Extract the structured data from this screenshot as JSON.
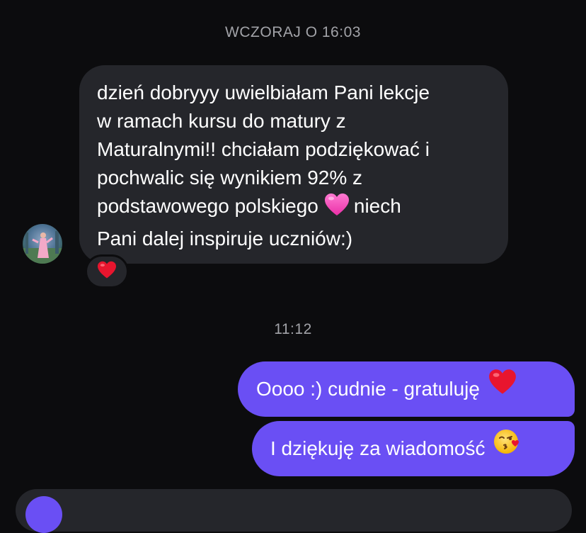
{
  "thread": {
    "timestamp_1": "WCZORAJ O 16:03",
    "timestamp_2": "11:12"
  },
  "incoming_message": {
    "lines": [
      "dzień dobryyy uwielbiałam Pani lekcje",
      "w ramach kursu do matury z",
      "Maturalnymi!! chciałam podziękować i",
      "pochwalic się wynikiem 92% z",
      "podstawowego polskiego",
      "niech",
      "Pani dalej inspiruje uczniów:)"
    ],
    "inline_emoji": "pink-heart-icon",
    "reaction_emoji": "red-heart-icon"
  },
  "outgoing_messages": [
    {
      "text": "Oooo :) cudnie - gratuluję",
      "emoji": "red-heart-icon"
    },
    {
      "text": "I dziękuję za wiadomość",
      "emoji": "face-blowing-kiss-icon"
    }
  ],
  "colors": {
    "background": "#0c0c0e",
    "incoming_bubble": "#25262b",
    "outgoing_bubble": "#6a4ff4",
    "timestamp": "#a2a3a8"
  }
}
